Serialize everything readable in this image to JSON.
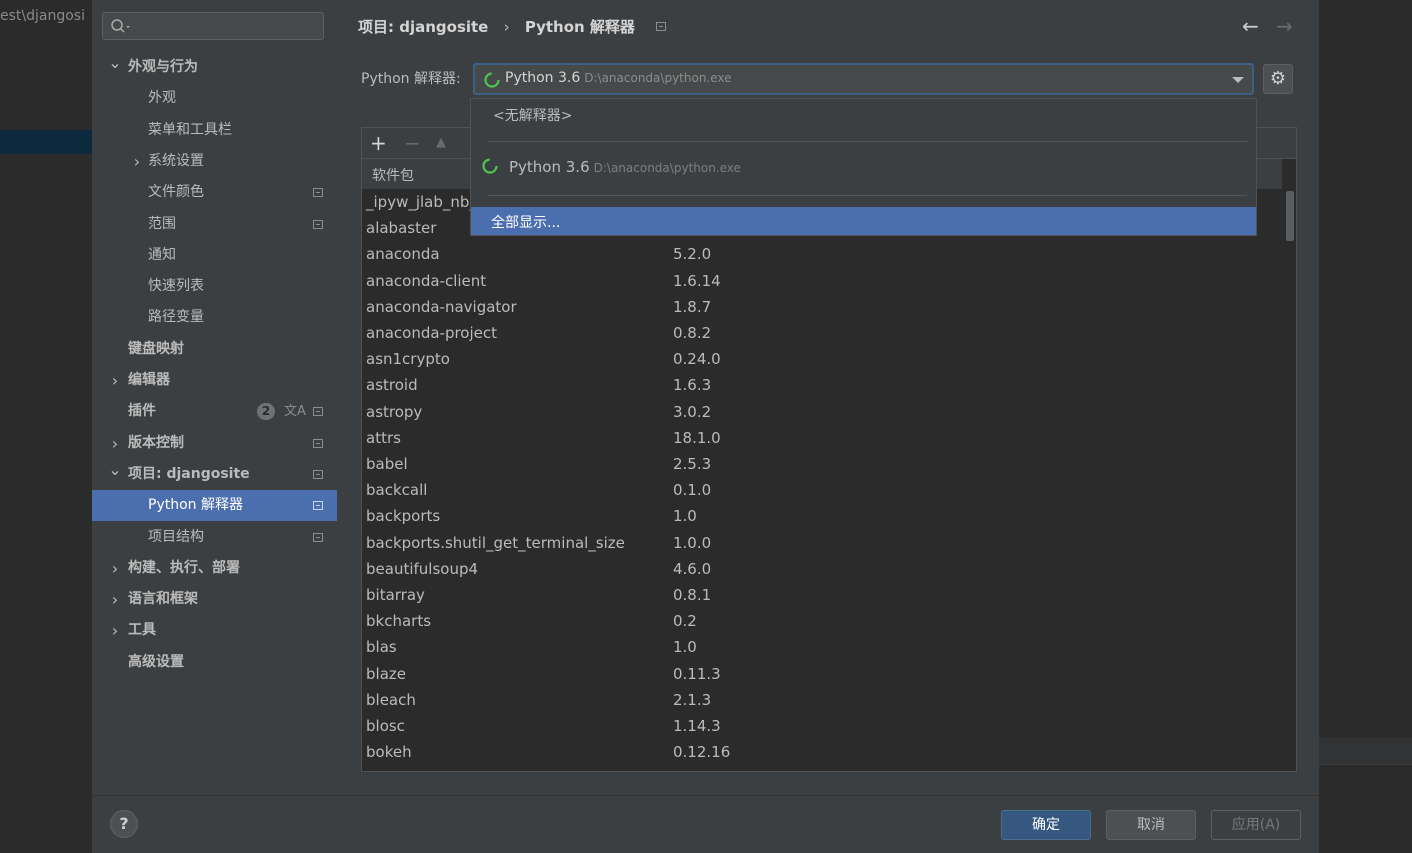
{
  "background": {
    "path_fragment": "est\\djangosi"
  },
  "sidebar": {
    "items": [
      {
        "label": "外观与行为",
        "bold": true,
        "arrow": "expanded"
      },
      {
        "label": "外观"
      },
      {
        "label": "菜单和工具栏"
      },
      {
        "label": "系统设置",
        "arrow": "collapsed"
      },
      {
        "label": "文件颜色",
        "page_icon": true
      },
      {
        "label": "范围",
        "page_icon": true
      },
      {
        "label": "通知"
      },
      {
        "label": "快速列表"
      },
      {
        "label": "路径变量"
      },
      {
        "label": "键盘映射",
        "bold": true
      },
      {
        "label": "编辑器",
        "bold": true,
        "arrow": "collapsed"
      },
      {
        "label": "插件",
        "bold": true,
        "badge": "2",
        "page_icon": true
      },
      {
        "label": "版本控制",
        "bold": true,
        "arrow": "collapsed",
        "page_icon": true
      },
      {
        "label": "项目: djangosite",
        "bold": true,
        "arrow": "expanded",
        "page_icon": true
      },
      {
        "label": "Python 解释器",
        "active": true,
        "page_icon": true
      },
      {
        "label": "项目结构",
        "page_icon": true
      },
      {
        "label": "构建、执行、部署",
        "bold": true,
        "arrow": "collapsed"
      },
      {
        "label": "语言和框架",
        "bold": true,
        "arrow": "collapsed"
      },
      {
        "label": "工具",
        "bold": true,
        "arrow": "collapsed"
      },
      {
        "label": "高级设置",
        "bold": true
      }
    ]
  },
  "header": {
    "breadcrumb_project": "项目: djangosite",
    "breadcrumb_sep": "›",
    "breadcrumb_page": "Python 解释器",
    "back_icon": "←",
    "forward_icon": "→"
  },
  "interpreter": {
    "label": "Python 解释器:",
    "selected_name": "Python 3.6",
    "selected_path": "D:\\anaconda\\python.exe",
    "gear_icon": "⚙"
  },
  "dropdown": {
    "none_option": "<无解释器>",
    "option_name": "Python 3.6",
    "option_path": "D:\\anaconda\\python.exe",
    "show_all": "全部显示..."
  },
  "toolbar": {
    "add": "+",
    "remove": "−",
    "up": "▲"
  },
  "table": {
    "header_package": "软件包",
    "rows": [
      {
        "name": "_ipyw_jlab_nb_",
        "version": ""
      },
      {
        "name": "alabaster",
        "version": ""
      },
      {
        "name": "anaconda",
        "version": "5.2.0"
      },
      {
        "name": "anaconda-client",
        "version": "1.6.14"
      },
      {
        "name": "anaconda-navigator",
        "version": "1.8.7"
      },
      {
        "name": "anaconda-project",
        "version": "0.8.2"
      },
      {
        "name": "asn1crypto",
        "version": "0.24.0"
      },
      {
        "name": "astroid",
        "version": "1.6.3"
      },
      {
        "name": "astropy",
        "version": "3.0.2"
      },
      {
        "name": "attrs",
        "version": "18.1.0"
      },
      {
        "name": "babel",
        "version": "2.5.3"
      },
      {
        "name": "backcall",
        "version": "0.1.0"
      },
      {
        "name": "backports",
        "version": "1.0"
      },
      {
        "name": "backports.shutil_get_terminal_size",
        "version": "1.0.0"
      },
      {
        "name": "beautifulsoup4",
        "version": "4.6.0"
      },
      {
        "name": "bitarray",
        "version": "0.8.1"
      },
      {
        "name": "bkcharts",
        "version": "0.2"
      },
      {
        "name": "blas",
        "version": "1.0"
      },
      {
        "name": "blaze",
        "version": "0.11.3"
      },
      {
        "name": "bleach",
        "version": "2.1.3"
      },
      {
        "name": "blosc",
        "version": "1.14.3"
      },
      {
        "name": "bokeh",
        "version": "0.12.16"
      }
    ]
  },
  "footer": {
    "help": "?",
    "ok": "确定",
    "cancel": "取消",
    "apply": "应用(A)"
  },
  "colors": {
    "accent": "#4b6eaf",
    "spinner": "#4fc553"
  }
}
